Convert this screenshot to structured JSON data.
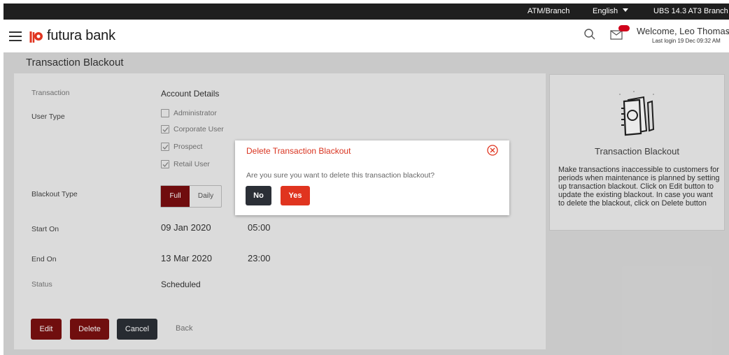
{
  "topbar": {
    "atm_branch": "ATM/Branch",
    "language": "English",
    "version": "UBS 14.3 AT3 Branch"
  },
  "header": {
    "brand": "futura bank",
    "welcome": "Welcome, Leo Thomas",
    "last_login": "Last login 19 Dec 09:32 AM",
    "icons": [
      "menu-icon",
      "search-icon",
      "mail-icon",
      "chevron-down-icon"
    ]
  },
  "page": {
    "title": "Transaction Blackout"
  },
  "form": {
    "transaction_label": "Transaction",
    "transaction_value": "Account Details",
    "user_type_label": "User Type",
    "user_types": [
      {
        "label": "Administrator",
        "checked": false
      },
      {
        "label": "Corporate User",
        "checked": true
      },
      {
        "label": "Prospect",
        "checked": true
      },
      {
        "label": "Retail User",
        "checked": true
      }
    ],
    "blackout_type_label": "Blackout Type",
    "blackout_options": [
      "Full",
      "Daily"
    ],
    "blackout_selected": "Full",
    "start_label": "Start On",
    "start_date": "09 Jan 2020",
    "start_time": "05:00",
    "end_label": "End On",
    "end_date": "13 Mar 2020",
    "end_time": "23:00",
    "status_label": "Status",
    "status_value": "Scheduled"
  },
  "actions": {
    "edit": "Edit",
    "delete": "Delete",
    "cancel": "Cancel",
    "back": "Back"
  },
  "side": {
    "title": "Transaction Blackout",
    "text": "Make transactions inaccessible to customers for periods when maintenance is planned by setting up transaction blackout. Click on Edit button to update the existing blackout. In case you want to delete the blackout, click on Delete button"
  },
  "dialog": {
    "title": "Delete Transaction Blackout",
    "message": "Are you sure you want to delete this transaction blackout?",
    "no": "No",
    "yes": "Yes"
  },
  "colors": {
    "accent": "#e0341f",
    "dark_button": "#2b2f36",
    "topbar": "#1f1f1f"
  }
}
